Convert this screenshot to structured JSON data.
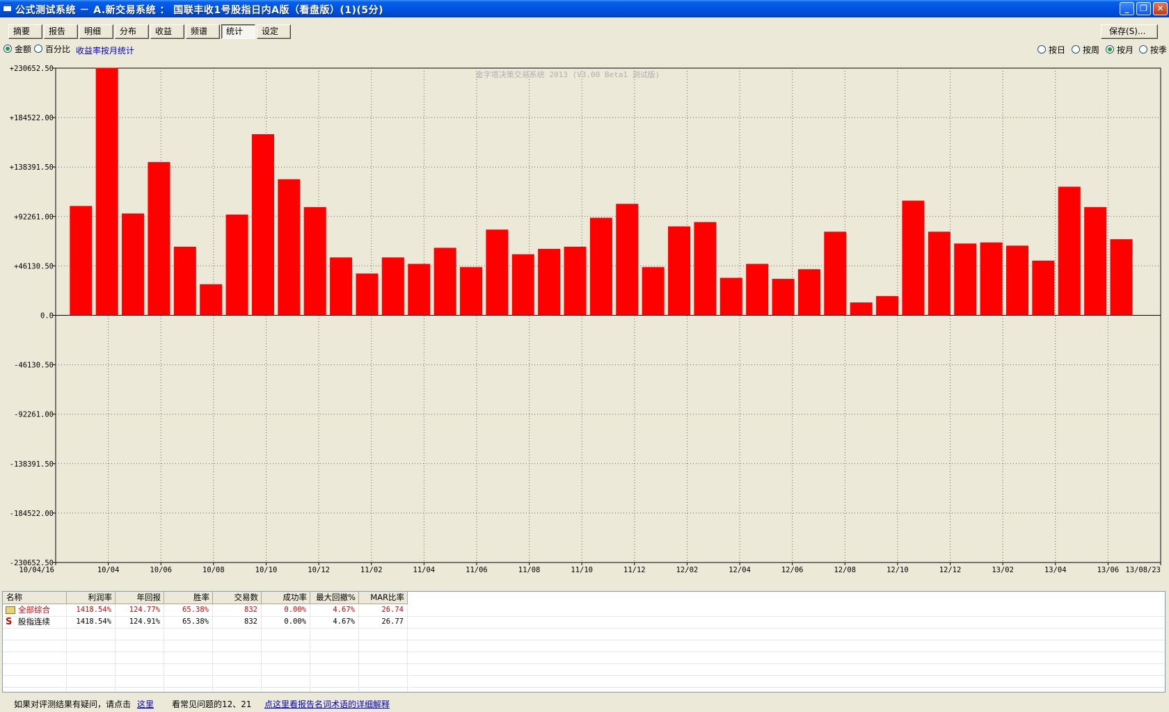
{
  "window": {
    "title": "公式测试系统 － A.新交易系统 ： 国联丰收1号股指日内A版（看盘版）(1)(5分)",
    "minimize_symbol": "_",
    "restore_symbol": "❐",
    "close_symbol": "✕"
  },
  "tabs": [
    {
      "label": "摘要"
    },
    {
      "label": "报告"
    },
    {
      "label": "明细"
    },
    {
      "label": "分布"
    },
    {
      "label": "收益"
    },
    {
      "label": "频谱"
    },
    {
      "label": "统计",
      "active": true
    },
    {
      "label": "设定"
    }
  ],
  "save_button": "保存(S)...",
  "mode_options": [
    {
      "label": "金额",
      "selected": true
    },
    {
      "label": "百分比",
      "selected": false
    }
  ],
  "stats_link": "收益率按月统计",
  "period_options": [
    {
      "label": "按日",
      "selected": false
    },
    {
      "label": "按周",
      "selected": false
    },
    {
      "label": "按月",
      "selected": true
    },
    {
      "label": "按季",
      "selected": false
    }
  ],
  "chart_data": {
    "type": "bar",
    "watermark": "金字塔决策交易系统 2013 (V3.00 Beta1 测试版)",
    "ylim": [
      -230652.5,
      230652.5
    ],
    "y_ticks": [
      "+230652.50",
      "+184522.00",
      "+138391.50",
      "+92261.00",
      "+46130.50",
      "0.0",
      "-46130.50",
      "-92261.00",
      "-138391.50",
      "-184522.00",
      "-230652.50"
    ],
    "x_ticks": [
      "10/04/16",
      "10/04",
      "10/06",
      "10/08",
      "10/10",
      "10/12",
      "11/02",
      "11/04",
      "11/06",
      "11/08",
      "11/10",
      "11/12",
      "12/02",
      "12/04",
      "12/06",
      "12/08",
      "12/10",
      "12/12",
      "13/02",
      "13/04",
      "13/06",
      "13/08/23"
    ],
    "color": "#ff0000",
    "values": [
      102000,
      231000,
      95000,
      143000,
      64000,
      29000,
      94000,
      169000,
      127000,
      101000,
      54000,
      39000,
      54000,
      48000,
      63000,
      45000,
      80000,
      57000,
      62000,
      64000,
      91000,
      104000,
      45000,
      83000,
      87000,
      35000,
      48000,
      34000,
      43000,
      78000,
      12000,
      18000,
      107000,
      78000,
      67000,
      68000,
      65000,
      51000,
      120000,
      101000,
      71000
    ]
  },
  "table": {
    "headers": [
      "名称",
      "利润率",
      "年回报",
      "胜率",
      "交易数",
      "成功率",
      "最大回撤%",
      "MAR比率"
    ],
    "rows": [
      {
        "icon": "folder-icon",
        "name": "全部综合",
        "profit": "1418.54%",
        "annual": "124.77%",
        "win": "65.38%",
        "trades": "832",
        "success": "0.00%",
        "drawdown": "4.67%",
        "mar": "26.74"
      },
      {
        "icon": "s-icon",
        "icon_glyph": "S",
        "name": "股指连续",
        "profit": "1418.54%",
        "annual": "124.91%",
        "win": "65.38%",
        "trades": "832",
        "success": "0.00%",
        "drawdown": "4.67%",
        "mar": "26.77"
      }
    ]
  },
  "status": {
    "prefix": "如果对评测结果有疑问，请点击",
    "here_link": "这里",
    "faq": "看常见问题的12、21",
    "glossary_link": "点这里看报告名词术语的详细解释"
  }
}
